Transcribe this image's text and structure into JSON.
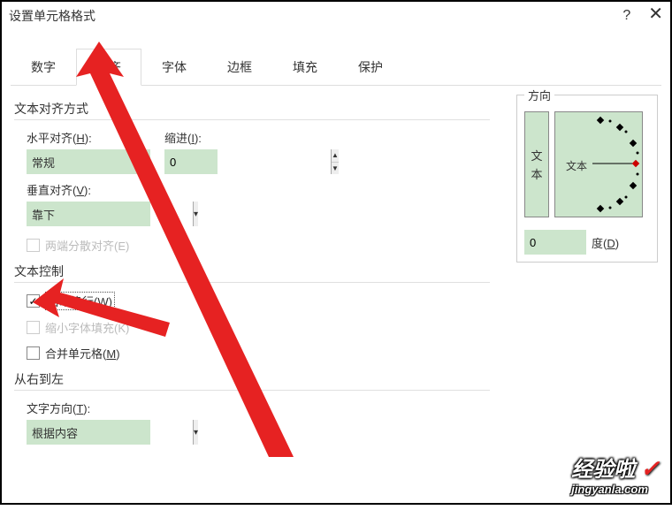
{
  "window": {
    "title": "设置单元格格式",
    "help": "?",
    "close": "✕"
  },
  "tabs": {
    "items": [
      {
        "label": "数字"
      },
      {
        "label": "对齐",
        "active": true
      },
      {
        "label": "字体"
      },
      {
        "label": "边框"
      },
      {
        "label": "填充"
      },
      {
        "label": "保护"
      }
    ]
  },
  "text_align": {
    "section": "文本对齐方式",
    "h_label_pre": "水平对齐(",
    "h_label_u": "H",
    "h_label_post": "):",
    "h_value": "常规",
    "indent_label_pre": "缩进(",
    "indent_label_u": "I",
    "indent_label_post": "):",
    "indent_value": "0",
    "v_label_pre": "垂直对齐(",
    "v_label_u": "V",
    "v_label_post": "):",
    "v_value": "靠下",
    "justify_distributed": "两端分散对齐(E)"
  },
  "text_control": {
    "section": "文本控制",
    "wrap_pre": "自动换行(",
    "wrap_u": "W",
    "wrap_post": ")",
    "wrap_checked": true,
    "shrink": "缩小字体填充(K)",
    "merge_pre": "合并单元格(",
    "merge_u": "M",
    "merge_post": ")"
  },
  "rtl": {
    "section": "从右到左",
    "dir_label_pre": "文字方向(",
    "dir_label_u": "T",
    "dir_label_post": "):",
    "dir_value": "根据内容"
  },
  "orientation": {
    "box_title": "方向",
    "vert_char_1": "文",
    "vert_char_2": "本",
    "dial_text": "文本",
    "deg_value": "0",
    "deg_label_pre": "度(",
    "deg_label_u": "D",
    "deg_label_post": ")"
  },
  "watermark": {
    "big": "经验啦",
    "small": "jingyanla.com"
  }
}
